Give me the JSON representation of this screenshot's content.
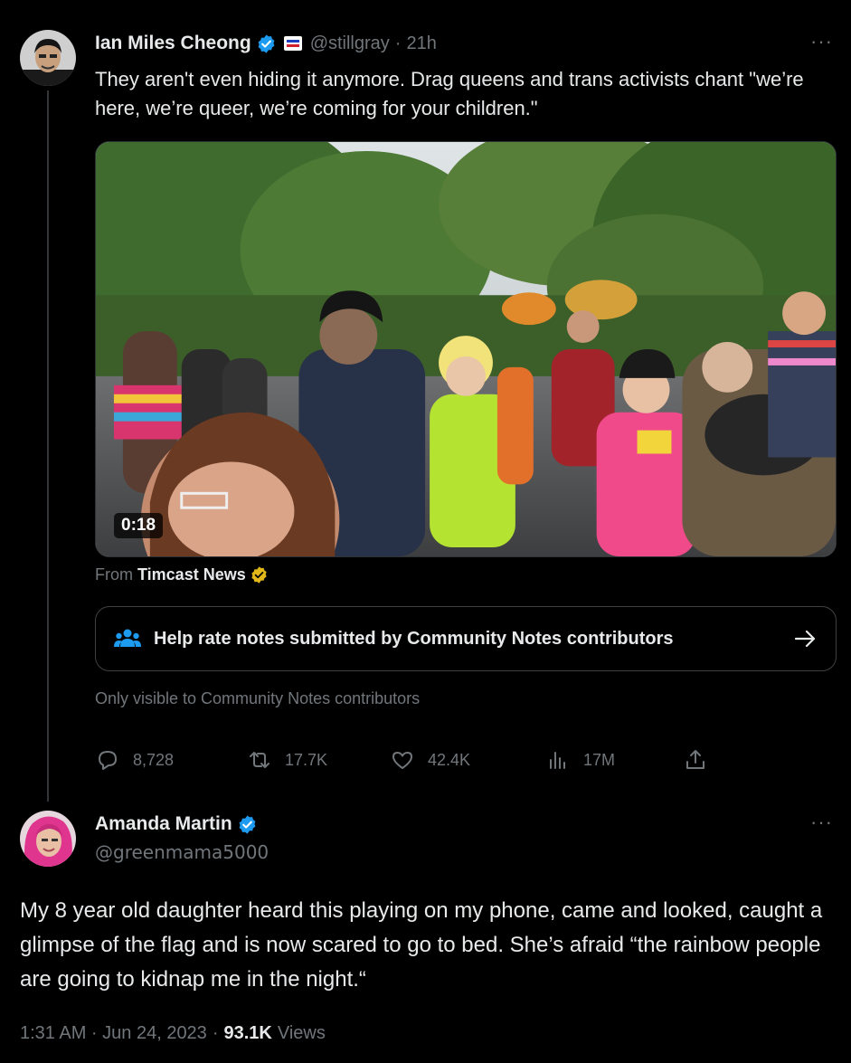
{
  "tweet": {
    "author_name": "Ian Miles Cheong",
    "author_handle": "@stillgray",
    "separator": "·",
    "time_ago": "21h",
    "more": "···",
    "text": "They aren't even hiding it anymore. Drag queens and trans activists chant \"we’re here, we’re queer, we’re coming for your children.\"",
    "video_duration": "0:18",
    "source_prefix": "From",
    "source_name": "Timcast News",
    "community_notes_label": "Help rate notes submitted by Community Notes contributors",
    "visibility_note": "Only visible to Community Notes contributors",
    "replies": "8,728",
    "retweets": "17.7K",
    "likes": "42.4K",
    "views": "17M"
  },
  "reply": {
    "author_name": "Amanda Martin",
    "author_handle": "@greenmama5000",
    "more": "···",
    "text": "My 8 year old daughter heard this playing on my phone, came and looked, caught a glimpse of the flag and is now scared to go to bed. She’s afraid “the rainbow people are going to kidnap me in the night.“",
    "timestamp": "1:31 AM · Jun 24, 2023",
    "separator": "·",
    "views_count": "93.1K",
    "views_label": "Views"
  },
  "colors": {
    "background": "#000000",
    "text_primary": "#e7e9ea",
    "text_secondary": "#71767b",
    "verified_blue": "#1d9bf0",
    "verified_gold": "#e2b719",
    "border": "#2f3336"
  },
  "icons": [
    "verified-badge-icon",
    "flag-affiliate-icon",
    "more-icon",
    "gold-verified-icon",
    "community-notes-icon",
    "arrow-right-icon",
    "reply-icon",
    "retweet-icon",
    "like-icon",
    "views-icon",
    "share-icon"
  ]
}
